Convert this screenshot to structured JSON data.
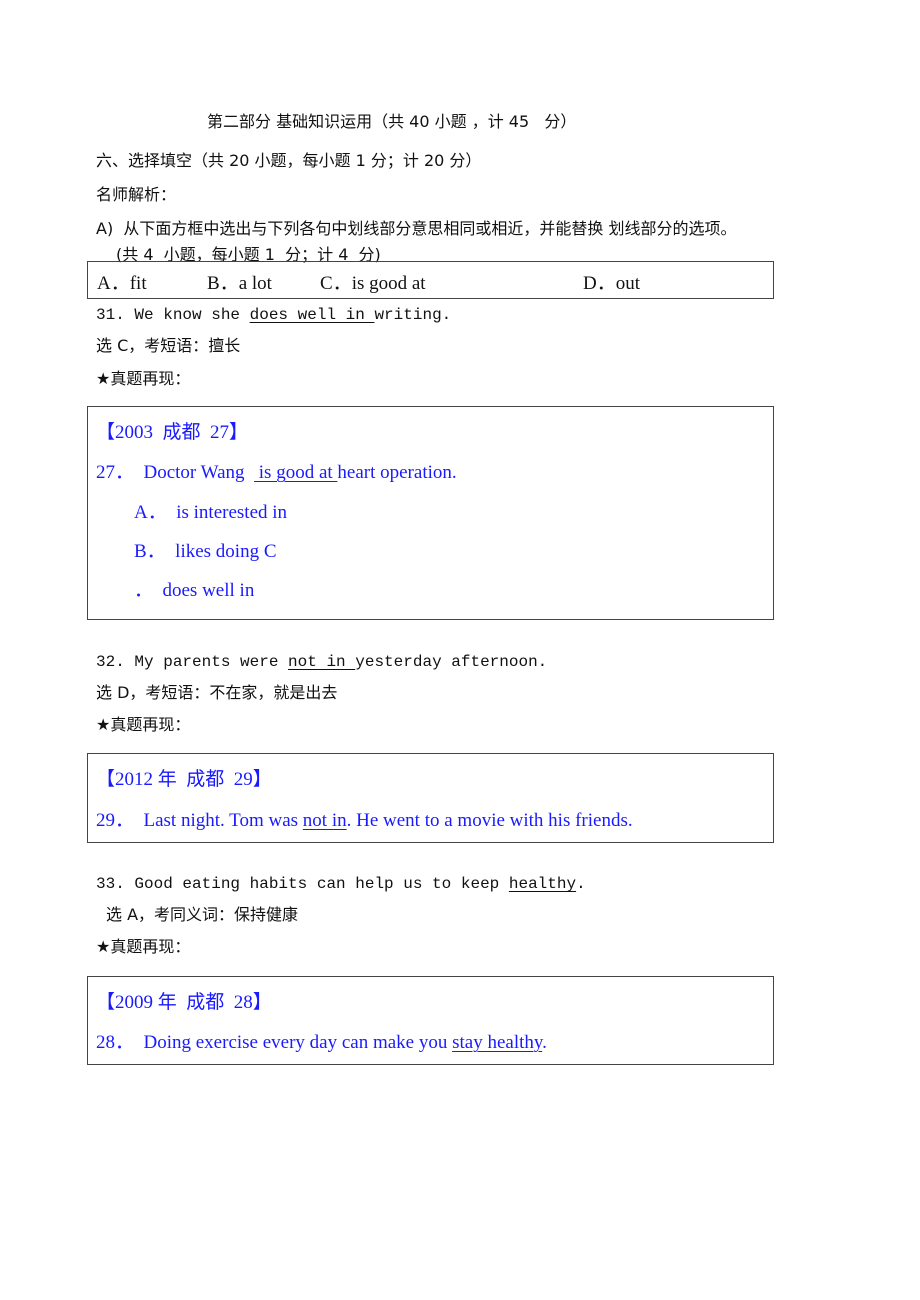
{
  "part_title": "第二部分 基础知识运用（共 40 小题 ，计 45   分）",
  "section_title": "六、选择填空（共 20 小题，每小题 1 分；计 20 分）",
  "analysis_label": "名师解析：",
  "instruction": {
    "line1": "A)  从下面方框中选出与下列各句中划线部分意思相同或相近，并能替换 划线部分的选项。",
    "line2": "(共 4  小题，每小题 1  分；计 4  分)"
  },
  "options": [
    {
      "letter": "A．",
      "text": "fit"
    },
    {
      "letter": "B．",
      "text": "a lot"
    },
    {
      "letter": "C．",
      "text": "is good at"
    },
    {
      "letter": "D．",
      "text": "out"
    }
  ],
  "recap_label": "★真题再现：",
  "questions": [
    {
      "sentence_before": "31. We know she ",
      "sentence_underlined": "does well in ",
      "sentence_after": "writing.",
      "answer": "选 C，考短语：擅长",
      "exam": {
        "source": "【2003  成都  27】",
        "stem_before": "27．  Doctor Wang  ",
        "stem_underlined": " is good at ",
        "stem_after": "heart operation.",
        "choices": [
          "A．  is interested in",
          "B．  likes doing C",
          "．  does well in"
        ]
      }
    },
    {
      "sentence_before": "32. My parents were ",
      "sentence_underlined": "not in ",
      "sentence_after": "yesterday afternoon.",
      "answer": "选 D，考短语：不在家，就是出去",
      "exam": {
        "source": "【2012 年  成都  29】",
        "stem_before": "29．  Last night. Tom was ",
        "stem_underlined": "not in",
        "stem_after": ". He went to a movie with his friends."
      }
    },
    {
      "sentence_before": "33. Good eating habits can help us to keep ",
      "sentence_underlined": "healthy",
      "sentence_after": ".",
      "answer": "选 A，考同义词：保持健康",
      "exam": {
        "source": "【2009 年  成都  28】",
        "stem_before": "28．  Doing exercise every day can make you ",
        "stem_underlined": "stay healthy",
        "stem_after": "."
      }
    }
  ]
}
